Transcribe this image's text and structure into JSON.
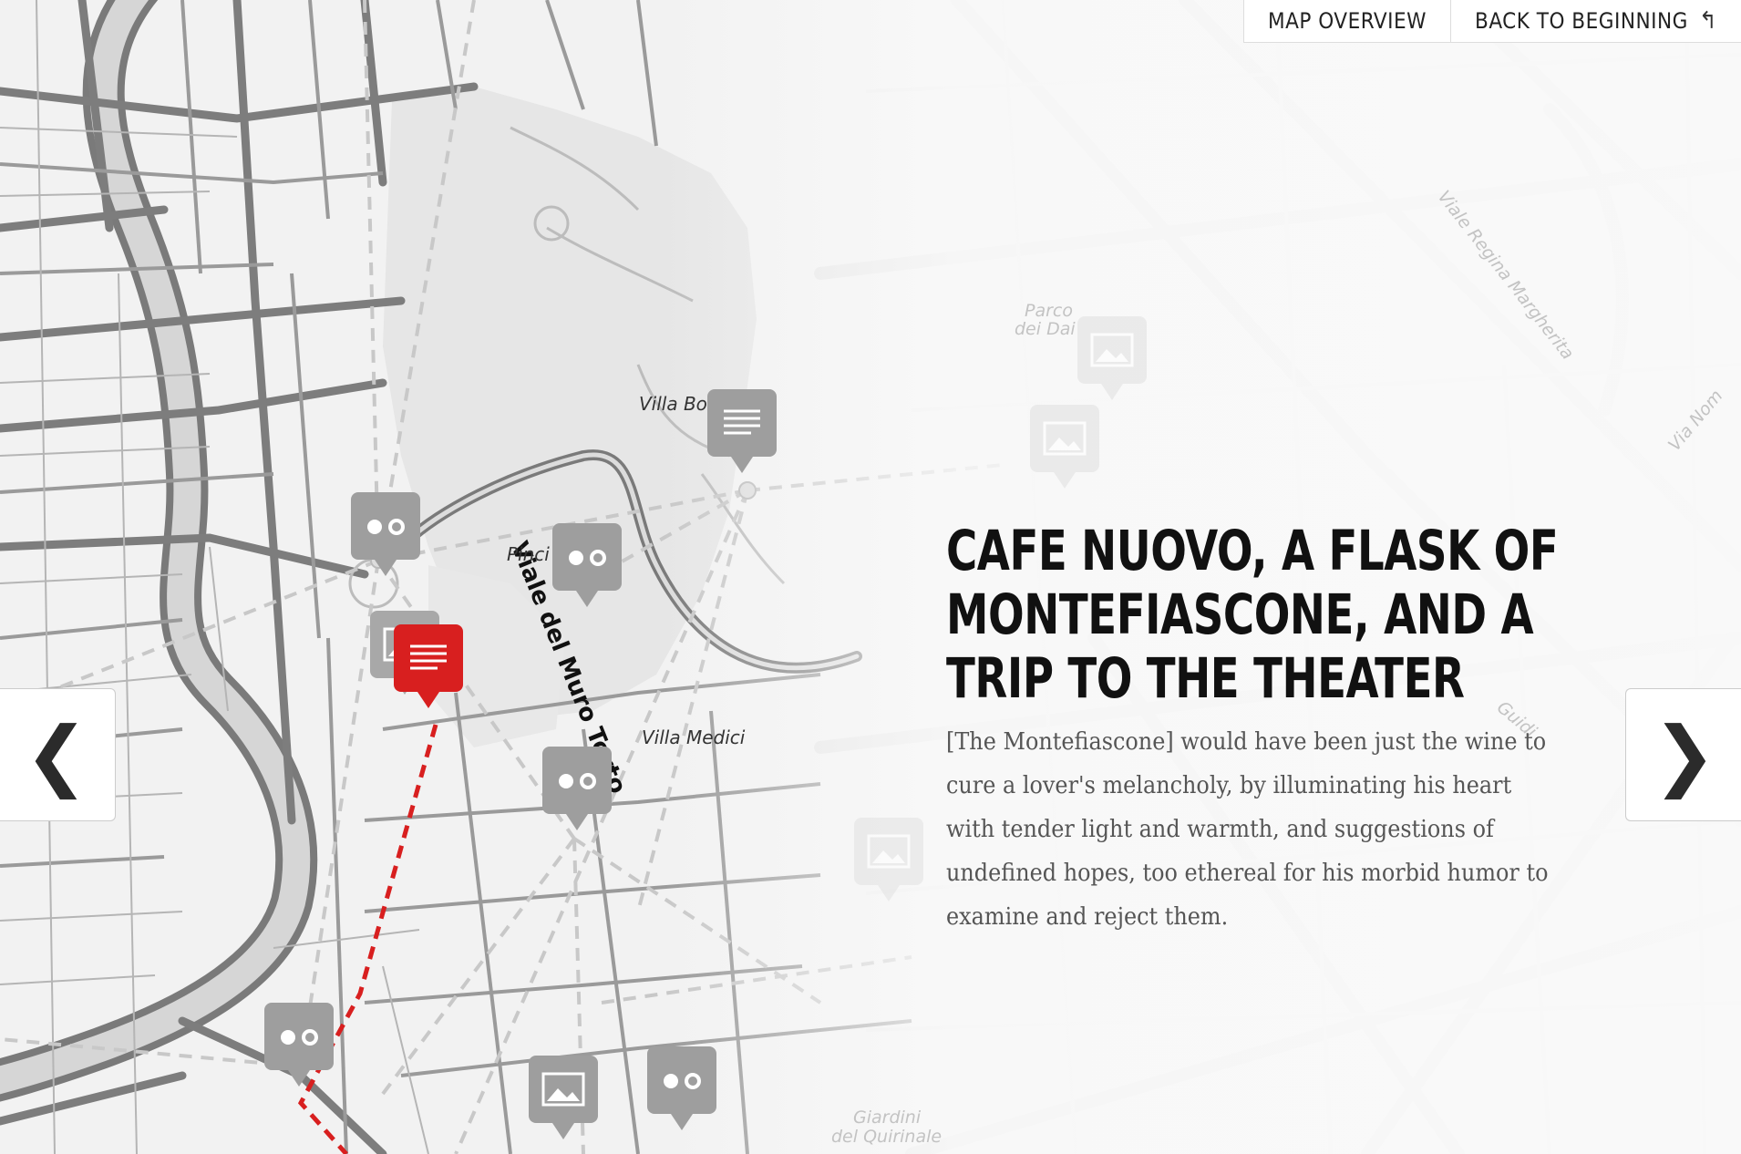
{
  "nav": {
    "map_overview": "MAP OVERVIEW",
    "back_to_beginning": "BACK TO BEGINNING",
    "back_icon": "undo-arrow-icon"
  },
  "controls": {
    "prev_glyph": "❮",
    "next_glyph": "❯",
    "prev_icon": "chevron-left-icon",
    "next_icon": "chevron-right-icon"
  },
  "story": {
    "title": "CAFE NUOVO, A FLASK OF MONTEFIASCONE, AND A TRIP TO THE THEATER",
    "body": "[The Montefiascone] would have been just the wine to cure a lover's melancholy, by illuminating his heart with tender light and warmth, and suggestions of undefined hopes, too ethereal for his morbid humor to examine and reject them."
  },
  "map": {
    "labels": {
      "villa_borghese": "Villa Bo",
      "viale_muro_torto": "Viale del Muro Torto",
      "pincio": "Pinci",
      "villa_medici": "Villa Medici",
      "parco_line1": "Parco",
      "parco_line2": "dei Dai",
      "viale_regina": "Viale Regina Margherita",
      "via_nom": "Via Nom",
      "giardini_line1": "Giardini",
      "giardini_line2": "del Quirinale",
      "guidi": "Guidi"
    },
    "colors": {
      "active": "#d81f1f",
      "marker": "#9e9e9e",
      "faded_marker": "#e0e0e0",
      "route": "#d81f1f"
    },
    "marker_types": [
      "text-icon",
      "flickr-dots-icon",
      "image-icon"
    ]
  }
}
